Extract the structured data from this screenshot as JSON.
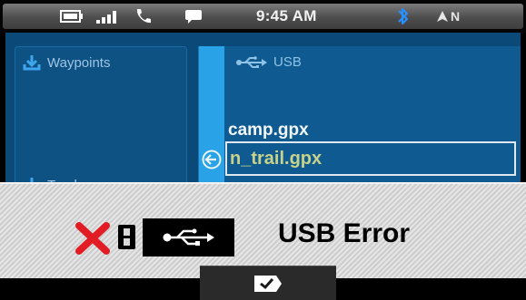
{
  "status_bar": {
    "time": "9:45 AM",
    "compass_letter": "N",
    "icons": [
      "battery-icon",
      "signal-icon",
      "phone-icon",
      "message-icon",
      "bluetooth-icon",
      "compass-arrow-icon"
    ]
  },
  "sidebar": {
    "items": [
      {
        "label": "Waypoints",
        "icon": "download-icon"
      },
      {
        "label": "Tracks",
        "icon": "download-icon"
      }
    ]
  },
  "browser": {
    "location": "USB",
    "files": [
      "camp.gpx",
      "n_trail.gpx"
    ],
    "selected_index": 1
  },
  "dialog": {
    "message": "USB Error",
    "icons": [
      "error-x-icon",
      "fault-icon",
      "usb-icon"
    ],
    "confirm_icon": "checkmark-icon"
  },
  "colors": {
    "screen_blue": "#0b4a78",
    "highlight_strip": "#29a2e7",
    "bluetooth": "#2a8fff",
    "error_red": "#e11c24",
    "selected_text": "#c9d28a"
  }
}
